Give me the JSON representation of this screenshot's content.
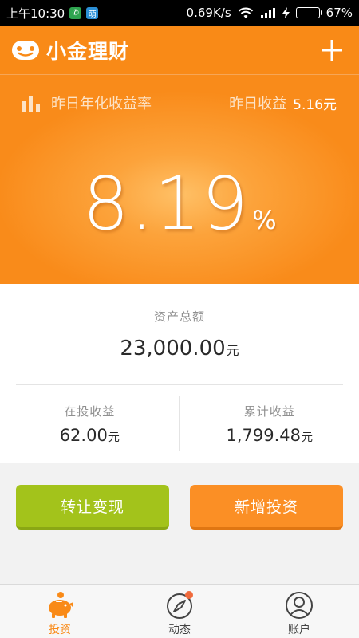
{
  "status_bar": {
    "time": "上午10:30",
    "badge_wechat": "✆",
    "badge_app": "萌",
    "speed": "0.69K/s",
    "battery": "67%",
    "battery_level": 0.67
  },
  "header": {
    "app_name": "小金理财",
    "add_icon": "plus-icon"
  },
  "hero": {
    "rate_label": "昨日年化收益率",
    "yield_label": "昨日收益",
    "yield_value": "5.16元",
    "rate_value": "8.19",
    "rate_unit": "%"
  },
  "assets": {
    "title": "资产总额",
    "total_value": "23,000.00",
    "total_unit": "元",
    "in_progress_label": "在投收益",
    "in_progress_value": "62.00",
    "in_progress_unit": "元",
    "cumulative_label": "累计收益",
    "cumulative_value": "1,799.48",
    "cumulative_unit": "元"
  },
  "actions": {
    "transfer_label": "转让变现",
    "invest_label": "新增投资"
  },
  "tabs": [
    {
      "label": "投资",
      "icon": "piggy-bank-icon",
      "active": true
    },
    {
      "label": "动态",
      "icon": "compass-icon",
      "active": false
    },
    {
      "label": "账户",
      "icon": "user-icon",
      "active": false
    }
  ],
  "colors": {
    "brand_orange": "#f98a17",
    "transfer_green": "#a3c31b",
    "invest_orange": "#fb8f25"
  }
}
